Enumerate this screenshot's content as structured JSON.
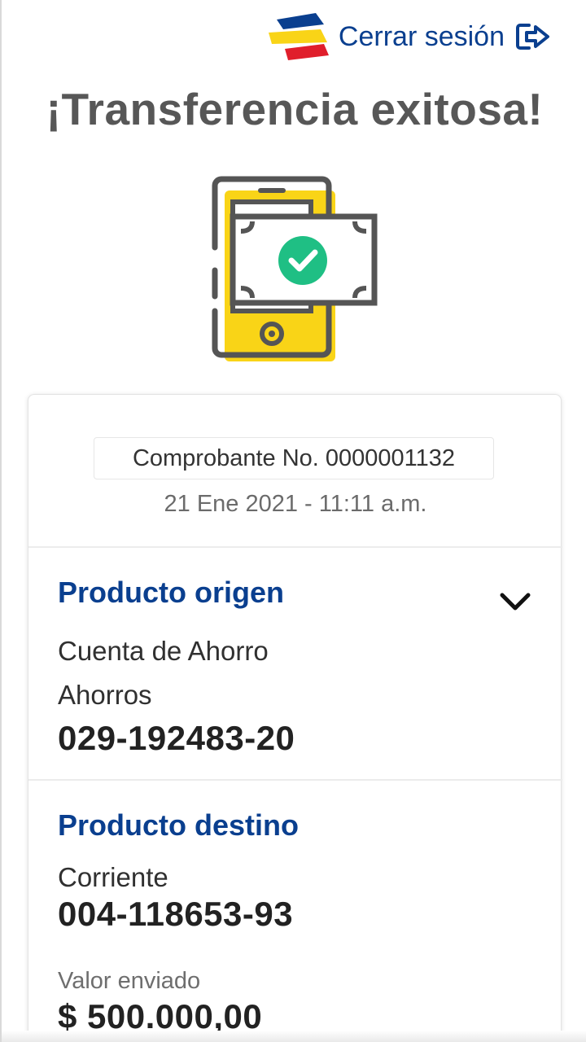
{
  "header": {
    "logout_label": "Cerrar sesión",
    "logo_icon": "bank-logo-icon",
    "logout_icon": "logout-arrow-icon"
  },
  "title": "¡Transferencia exitosa!",
  "hero_icon": "phone-money-check-icon",
  "receipt": {
    "number_text": "Comprobante No. 0000001132",
    "datetime": "21 Ene 2021 - 11:11 a.m."
  },
  "origin": {
    "title": "Producto origen",
    "product_name": "Cuenta de Ahorro",
    "account_type": "Ahorros",
    "account_number": "029-192483-20"
  },
  "destination": {
    "title": "Producto destino",
    "account_type": "Corriente",
    "account_number": "004-118653-93"
  },
  "amount": {
    "label": "Valor enviado",
    "value": "$ 500.000,00"
  },
  "colors": {
    "brand_blue": "#0a3f8f",
    "accent_yellow": "#f9d417",
    "success_green": "#1fbf84",
    "logo_red": "#e01e2b"
  }
}
